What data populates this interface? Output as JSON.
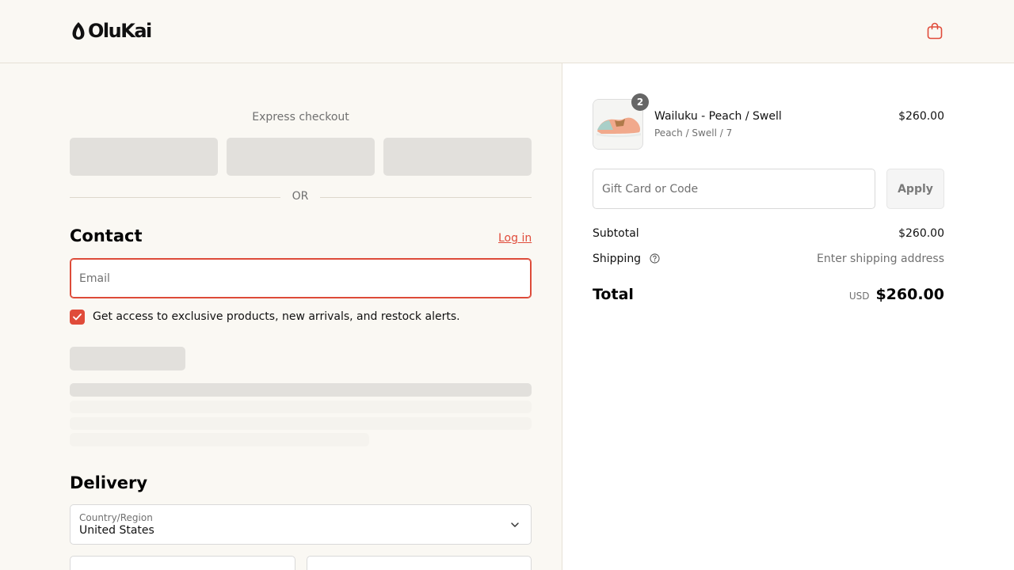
{
  "header": {
    "logo_text": "OluKai",
    "cart_icon": "shopping-bag-icon",
    "accent_color": "#e04b3a"
  },
  "checkout": {
    "express_title": "Express checkout",
    "or_text": "OR",
    "contact": {
      "title": "Contact",
      "login_label": "Log in",
      "email_placeholder": "Email",
      "email_value": "",
      "marketing_checked": true,
      "marketing_label": "Get access to exclusive products, new arrivals, and restock alerts."
    },
    "delivery": {
      "title": "Delivery",
      "country_label": "Country/Region",
      "country_value": "United States"
    }
  },
  "summary": {
    "item": {
      "quantity": "2",
      "name": "Wailuku - Peach / Swell",
      "variant": "Peach / Swell / 7",
      "price": "$260.00"
    },
    "gift_placeholder": "Gift Card or Code",
    "apply_label": "Apply",
    "subtotal_label": "Subtotal",
    "subtotal_value": "$260.00",
    "shipping_label": "Shipping",
    "shipping_value": "Enter shipping address",
    "total_label": "Total",
    "currency": "USD",
    "total_value": "$260.00"
  }
}
